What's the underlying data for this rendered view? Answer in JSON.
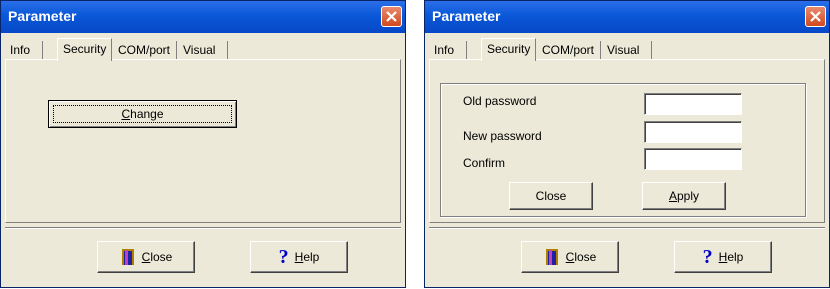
{
  "left_window": {
    "title": "Parameter",
    "tabs": [
      "Info",
      "Security",
      "COM/port",
      "Visual"
    ],
    "active_tab": "Security",
    "change_button": "Change",
    "footer": {
      "close_label": "Close",
      "help_label": "Help"
    }
  },
  "right_window": {
    "title": "Parameter",
    "tabs": [
      "Info",
      "Security",
      "COM/port",
      "Visual"
    ],
    "active_tab": "Security",
    "form": {
      "old_password_label": "Old password",
      "old_password_value": "",
      "new_password_label": "New password",
      "new_password_value": "",
      "confirm_label": "Confirm",
      "confirm_value": "",
      "close_label": "Close",
      "apply_label": "Apply"
    },
    "footer": {
      "close_label": "Close",
      "help_label": "Help"
    }
  },
  "colors": {
    "titlebar": "#0a58d8",
    "window_bg": "#ece9d8",
    "close_x": "#d04a1e",
    "help_icon": "#0000cc"
  },
  "icons": {
    "close_footer": "door-exit-icon",
    "help_footer": "question-mark-icon",
    "title_close": "close-icon"
  }
}
